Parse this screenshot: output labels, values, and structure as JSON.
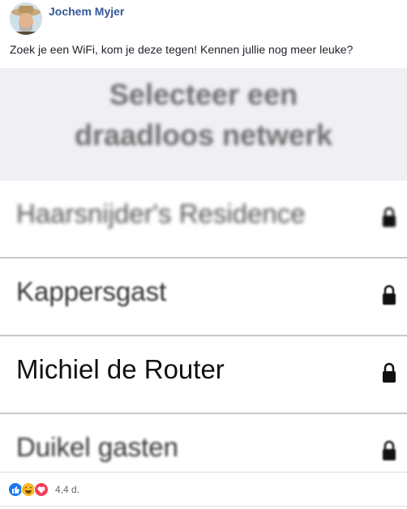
{
  "post": {
    "author": "Jochem Myjer",
    "text": "Zoek je een WiFi, kom je deze tegen! Kennen jullie nog meer leuke?"
  },
  "photo": {
    "title_line1": "Selecteer een",
    "title_line2": "draadloos netwerk",
    "networks": [
      {
        "name": "Haarsnijder's Residence",
        "icon": "lock-icon"
      },
      {
        "name": "Kappersgast",
        "icon": "lock-icon"
      },
      {
        "name": "Michiel de Router",
        "icon": "lock-icon"
      },
      {
        "name": "Duikel gasten",
        "icon": "lock-icon"
      }
    ]
  },
  "reactions": {
    "icons": [
      "like-icon",
      "haha-icon",
      "love-icon"
    ],
    "count": "4,4 d."
  },
  "colors": {
    "author": "#365899",
    "like": "#1877f2",
    "haha": "#f7b928",
    "love": "#f33e58"
  }
}
